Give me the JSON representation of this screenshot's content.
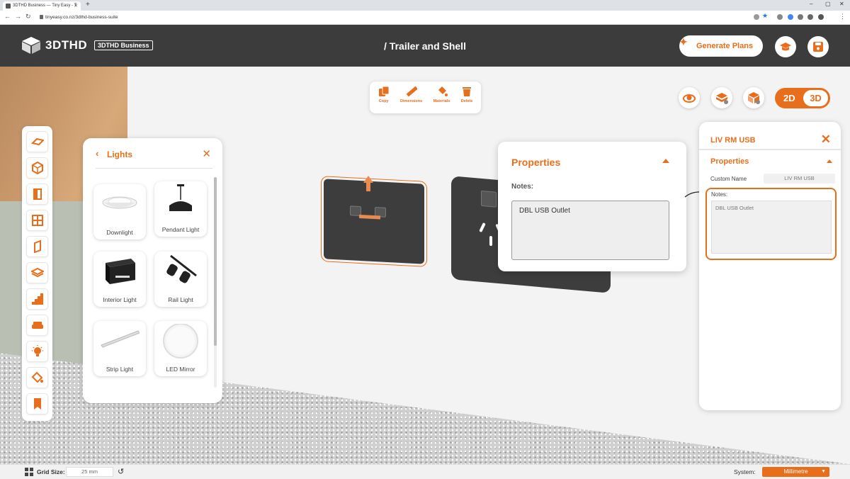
{
  "browser": {
    "tab_title": "3DTHD Business — Tiny Easy - T",
    "url": "tinyeasy.co.nz/3dthd-business-suite"
  },
  "header": {
    "logo_text": "3DTHD",
    "badge": "3DTHD Business",
    "page_title": "/ Trailer and Shell",
    "generate_plans": "Generate Plans"
  },
  "toolbar": {
    "copy": "Copy",
    "dimensions": "Dimensions",
    "materials": "Materials",
    "delete": "Delete"
  },
  "view_toggle": {
    "option_2d": "2D",
    "option_3d": "3D",
    "selected": "3D"
  },
  "lights_panel": {
    "title": "Lights",
    "items": [
      "Downlight",
      "Pendant Light",
      "Interior Light",
      "Rail Light",
      "Strip Light",
      "LED Mirror"
    ]
  },
  "properties_popup": {
    "title": "Properties",
    "notes_label": "Notes:",
    "notes_value": "DBL USB Outlet"
  },
  "right_panel": {
    "title": "LIV RM USB",
    "section": "Properties",
    "custom_name_label": "Custom Name",
    "custom_name_value": "LIV RM USB",
    "notes_label": "Notes:",
    "notes_value": "DBL USB Outlet"
  },
  "statusbar": {
    "grid_label": "Grid Size:",
    "grid_value": "25 mm",
    "system_label": "System:",
    "system_value": "Millimetre"
  },
  "colors": {
    "accent": "#e96e1b",
    "header_bg": "#3c3c3c"
  }
}
